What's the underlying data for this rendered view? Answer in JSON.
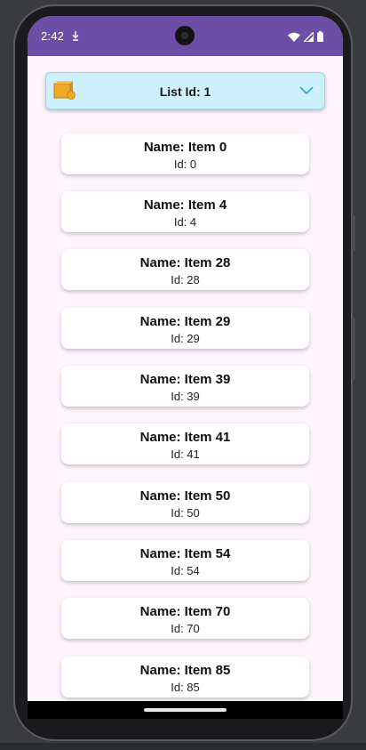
{
  "status_bar": {
    "time": "2:42",
    "small_icon": "download-icon",
    "right_icons": [
      "wifi-icon",
      "signal-icon",
      "battery-icon"
    ],
    "background": "#6d4ea6"
  },
  "dropdown": {
    "icon": "box-icon",
    "label": "List Id: 1",
    "chevron": "chevron-down-icon",
    "background": "#cdf0fb"
  },
  "items": [
    {
      "name": "Name: Item 0",
      "id": "Id: 0"
    },
    {
      "name": "Name: Item 4",
      "id": "Id: 4"
    },
    {
      "name": "Name: Item 28",
      "id": "Id: 28"
    },
    {
      "name": "Name: Item 29",
      "id": "Id: 29"
    },
    {
      "name": "Name: Item 39",
      "id": "Id: 39"
    },
    {
      "name": "Name: Item 41",
      "id": "Id: 41"
    },
    {
      "name": "Name: Item 50",
      "id": "Id: 50"
    },
    {
      "name": "Name: Item 54",
      "id": "Id: 54"
    },
    {
      "name": "Name: Item 70",
      "id": "Id: 70"
    },
    {
      "name": "Name: Item 85",
      "id": "Id: 85"
    }
  ],
  "nav": {
    "handle": "home-gesture-handle"
  }
}
